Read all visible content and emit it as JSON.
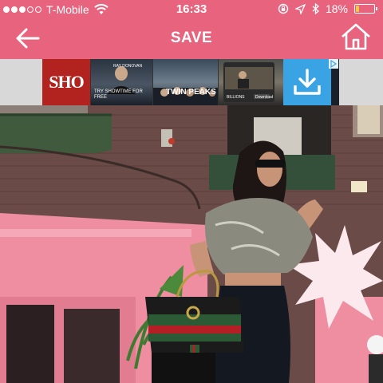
{
  "status_bar": {
    "signal_dots_filled": 3,
    "signal_dots_total": 5,
    "carrier": "T-Mobile",
    "time": "16:33",
    "battery_percent_text": "18%",
    "battery_level": 0.18,
    "icons": [
      "wifi-icon",
      "rotation-lock-icon",
      "location-icon",
      "bluetooth-icon",
      "battery-icon"
    ]
  },
  "nav": {
    "title": "SAVE",
    "back_icon": "arrow-left-icon",
    "home_icon": "home-icon"
  },
  "ad": {
    "logo_text": "SHO",
    "tile1_name": "RAY DONOVAN",
    "tile1_cta": "TRY SHOWTIME FOR FREE",
    "tile2_name": "TWIN PEAKS",
    "tile3_name": "BILLIONS",
    "tile3_button": "Download",
    "choices_icon": "ad-choices-icon",
    "download_icon": "download-icon"
  },
  "colors": {
    "header": "#e8647e",
    "ad_logo_red": "#b2221f",
    "ad_download_blue": "#3aa3e3",
    "battery_fill": "#f5c842"
  }
}
